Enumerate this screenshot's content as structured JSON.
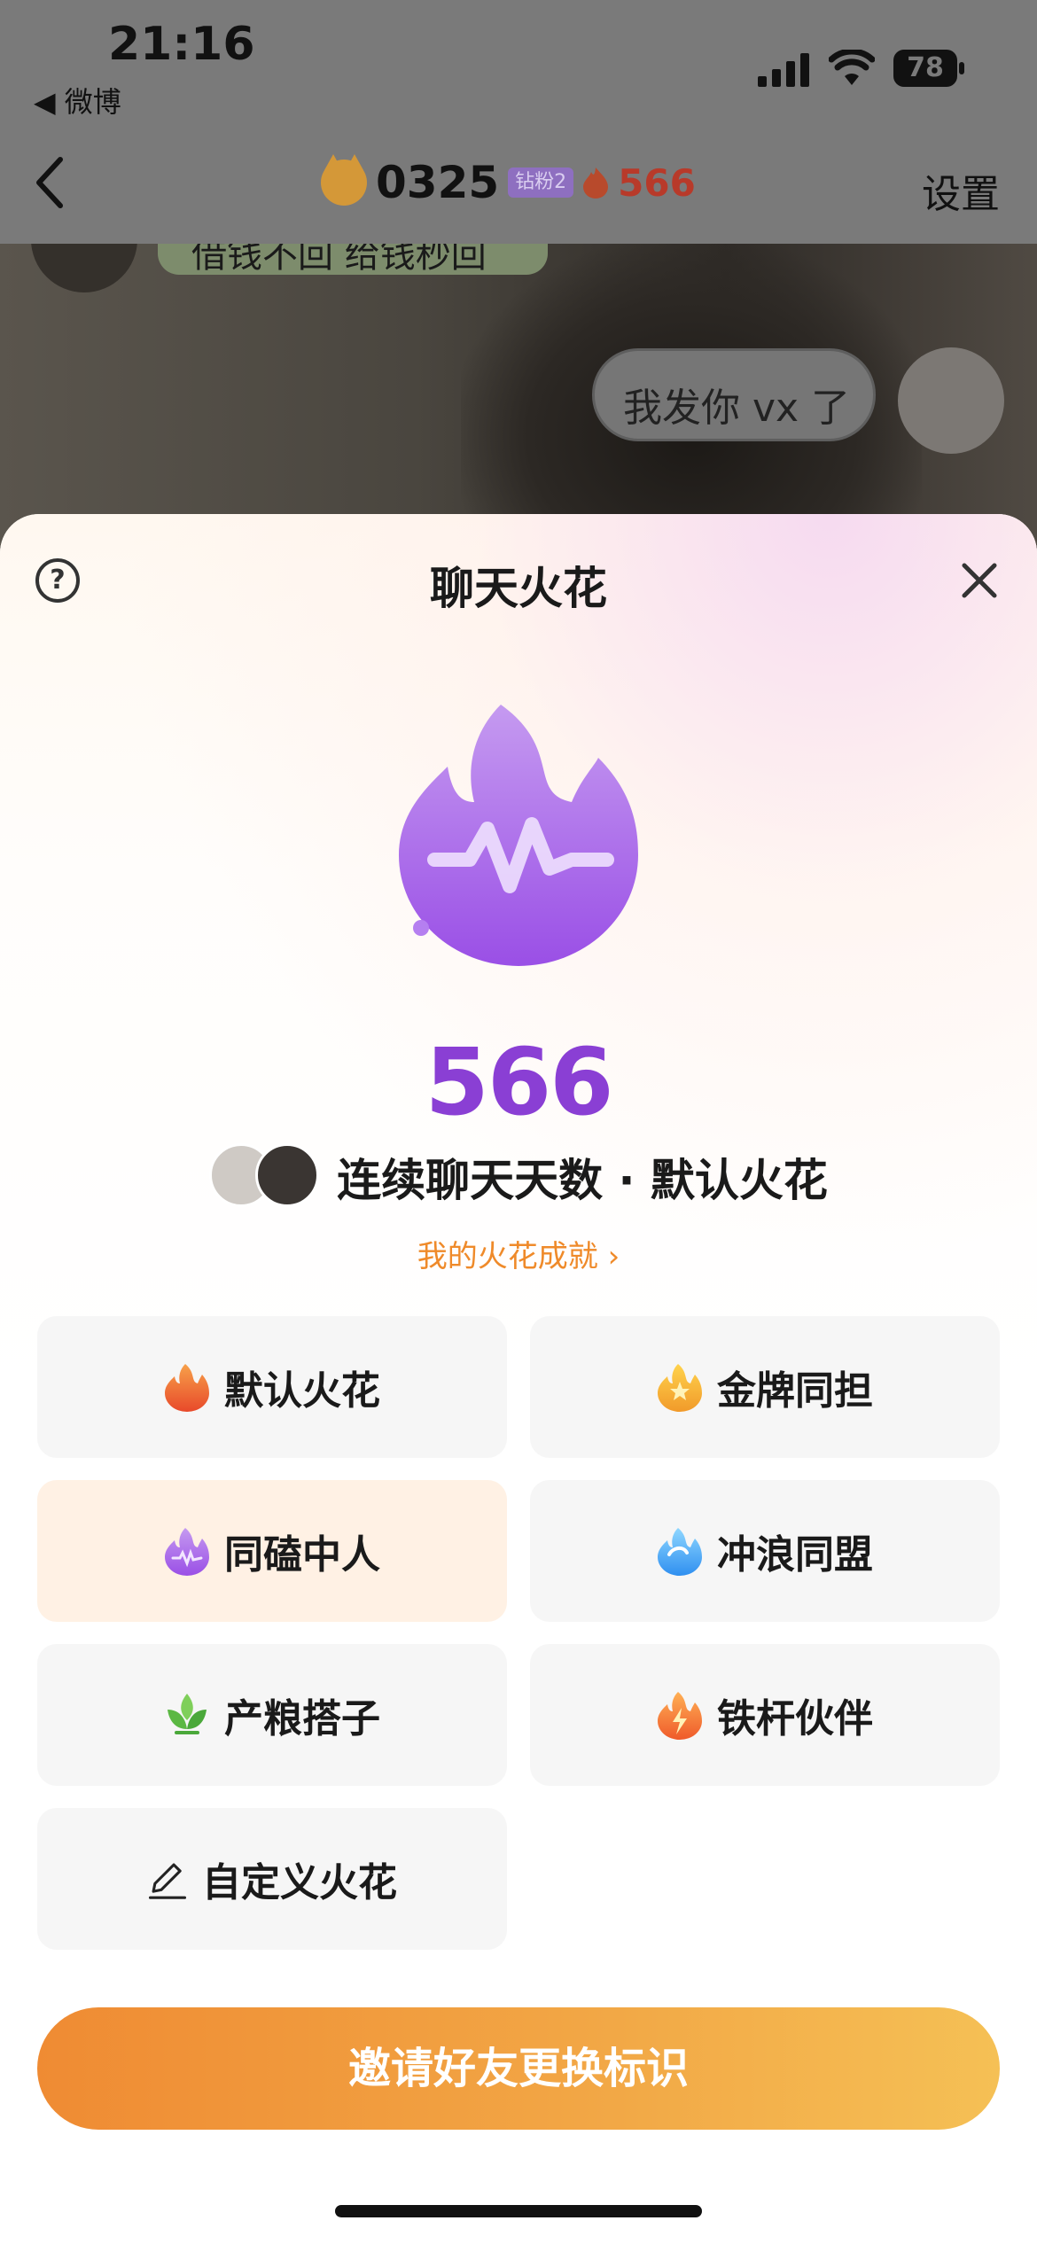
{
  "status_bar": {
    "time": "21:16",
    "back_app": "◀ 微博",
    "battery": "78"
  },
  "nav": {
    "name": "0325",
    "fan_badge": "钻粉2",
    "streak": "566",
    "settings": "设置"
  },
  "chat": {
    "top_message": "借钱不回 给钱秒回",
    "my_message": "我发你 vx 了"
  },
  "sheet": {
    "title": "聊天火花",
    "streak_number": "566",
    "streak_label": "连续聊天天数 · 默认火花",
    "achievements_link": "我的火花成就 ›",
    "badges": [
      {
        "label": "默认火花",
        "icon": "fire-orange-icon"
      },
      {
        "label": "金牌同担",
        "icon": "star-fire-icon"
      },
      {
        "label": "同磕中人",
        "icon": "purple-flame-icon",
        "selected": true
      },
      {
        "label": "冲浪同盟",
        "icon": "wave-flame-icon"
      },
      {
        "label": "产粮搭子",
        "icon": "leaf-icon"
      },
      {
        "label": "铁杆伙伴",
        "icon": "lightning-flame-icon"
      },
      {
        "label": "自定义火花",
        "icon": "pencil-icon"
      }
    ],
    "cta": "邀请好友更换标识"
  },
  "colors": {
    "accent_purple": "#8a3fd4",
    "accent_orange": "#ef8a2a",
    "selected_tile": "#fff1e4"
  }
}
